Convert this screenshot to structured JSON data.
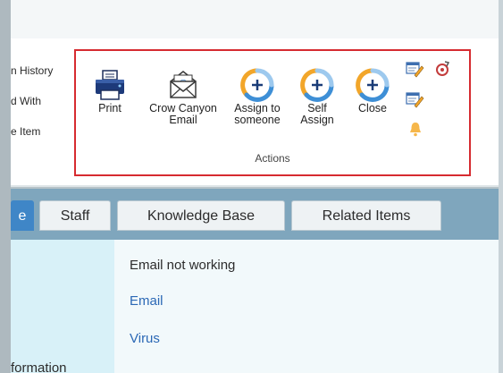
{
  "left_menu": [
    "n History",
    "d With",
    "e Item"
  ],
  "actions": {
    "group_label": "Actions",
    "print": {
      "line1": "Print",
      "line2": ""
    },
    "email": {
      "line1": "Crow Canyon",
      "line2": "Email"
    },
    "assign": {
      "line1": "Assign to",
      "line2": "someone"
    },
    "self_assign": {
      "line1": "Self",
      "line2": "Assign"
    },
    "close": {
      "line1": "Close",
      "line2": ""
    }
  },
  "tabs": [
    {
      "label": "e",
      "active": true
    },
    {
      "label": "Staff",
      "active": false
    },
    {
      "label": "Knowledge Base",
      "active": false
    },
    {
      "label": "Related Items",
      "active": false
    }
  ],
  "fields": [
    "Email not working",
    "Email",
    "Virus"
  ],
  "bottom_label": "formation",
  "colors": {
    "highlight_border": "#d62b30",
    "tab_bar": "#7fa6bd",
    "active_tab": "#3f86c7",
    "link": "#2b68b5",
    "circle_orange": "#f2a62a",
    "circle_blue": "#3e8fd6"
  }
}
